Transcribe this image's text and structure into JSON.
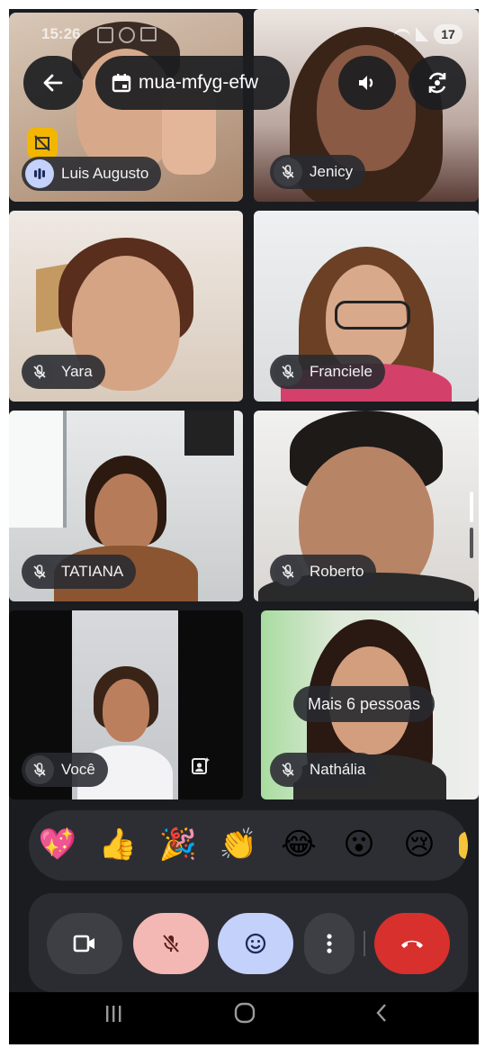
{
  "status_bar": {
    "time": "15:26",
    "battery": "17"
  },
  "top_bar": {
    "meeting_code": "mua-mfyg-efw"
  },
  "participants": [
    {
      "name": "Luis Augusto",
      "speaking": true
    },
    {
      "name": "Jenicy",
      "muted": true
    },
    {
      "name": "Yara",
      "muted": true
    },
    {
      "name": "Franciele",
      "muted": true
    },
    {
      "name": "TATIANA",
      "muted": true
    },
    {
      "name": "Roberto",
      "muted": true
    },
    {
      "name": "Você",
      "muted": true
    },
    {
      "name": "Nathália",
      "muted": true
    }
  ],
  "more_people_label": "Mais 6 pessoas",
  "reactions": [
    "💖",
    "👍",
    "🎉",
    "👏",
    "😂",
    "😮",
    "😢"
  ],
  "controls": {
    "camera": "camera-icon",
    "mic": "mic-off-icon",
    "emoji": "smile-icon",
    "more": "more-vert-icon",
    "end_call": "end-call-icon"
  },
  "colors": {
    "background": "#1b1c20",
    "active_border": "#8eaae6",
    "mic_button": "#f3b7b4",
    "emoji_button": "#c3d1fb",
    "end_call": "#d8302c"
  }
}
